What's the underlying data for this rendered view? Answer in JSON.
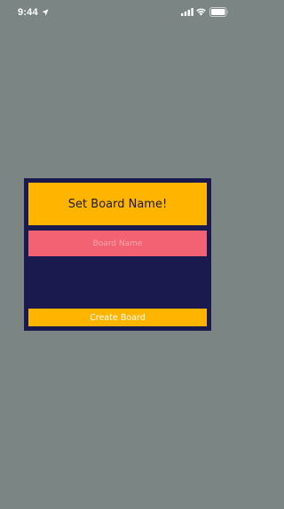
{
  "status_bar": {
    "time": "9:44",
    "icons": [
      "location-arrow-icon",
      "signal-icon",
      "wifi-icon",
      "battery-icon"
    ]
  },
  "dialog": {
    "title": "Set Board Name!",
    "input": {
      "value": "",
      "placeholder": "Board Name"
    },
    "create_label": "Create Board"
  },
  "colors": {
    "background": "#7b8584",
    "dialog": "#1a1a4e",
    "accent": "#ffb400",
    "input": "#f26272"
  }
}
